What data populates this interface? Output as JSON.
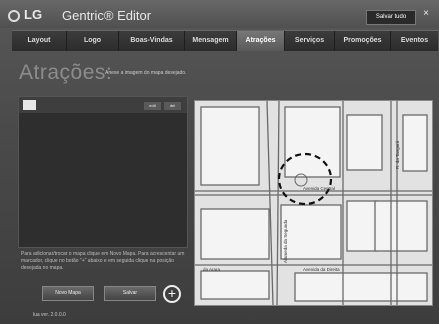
{
  "titlebar": {
    "logo": "LG",
    "app_title": "Gentric® Editor",
    "save_all": "Salvar tudo",
    "close": "×"
  },
  "nav": {
    "tabs": [
      {
        "label": "Layout"
      },
      {
        "label": "Logo"
      },
      {
        "label": "Boas-Vindas"
      },
      {
        "label": "Mensagem"
      },
      {
        "label": "Atrações",
        "active": true
      },
      {
        "label": "Serviços"
      },
      {
        "label": "Promoções"
      },
      {
        "label": "Eventos"
      }
    ]
  },
  "page": {
    "heading": "Atrações:",
    "subheading": "Anexe a imagem do mapa desejado."
  },
  "left_panel": {
    "btn_edit": "edit",
    "btn_del": "del",
    "instructions": "Para adicionar/trocar o mapa clique em Novo Mapa. Para acrescentar um marcador, clique no botão \"+\" abaixo e em seguida clique na posição desejada no mapa."
  },
  "buttons": {
    "new_map": "Novo Mapa",
    "save": "Salvar",
    "plus": "+"
  },
  "footer": {
    "version": "lua ver. 2.0.0.0"
  },
  "map": {
    "street_central": "Avenida Central",
    "street_segunda": "Alameda da Segunda",
    "street_direita": "Avenida da Direita",
    "street_arara": "da Arara",
    "street_tangara": "R. da Tangará"
  }
}
